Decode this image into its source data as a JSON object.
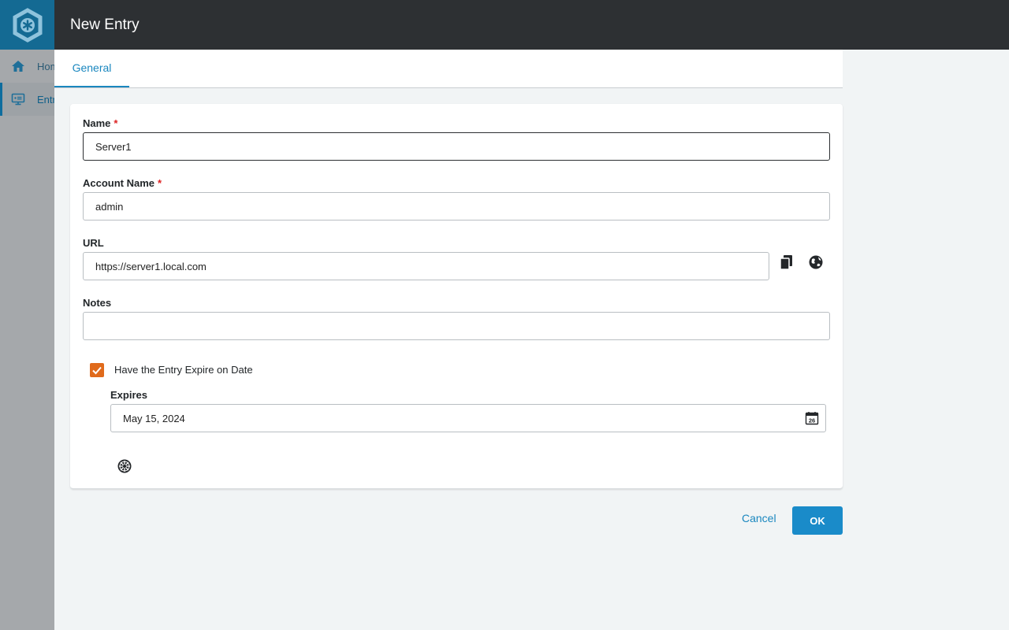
{
  "background_app": {
    "nav": [
      {
        "label": "Home",
        "icon": "home-icon"
      },
      {
        "label": "Entries",
        "icon": "entries-icon"
      }
    ]
  },
  "dialog": {
    "title": "New Entry",
    "tabs": [
      {
        "label": "General",
        "active": true
      }
    ],
    "fields": {
      "name": {
        "label": "Name",
        "required_marker": "*",
        "value": "Server1"
      },
      "account_name": {
        "label": "Account Name",
        "required_marker": "*",
        "value": "admin"
      },
      "url": {
        "label": "URL",
        "value": "https://server1.local.com"
      },
      "notes": {
        "label": "Notes",
        "value": ""
      }
    },
    "expire": {
      "checkbox_label": "Have the Entry Expire on Date",
      "checked": true,
      "expires_label": "Expires",
      "expires_value": "May 15, 2024",
      "calendar_day": "26"
    },
    "buttons": {
      "cancel": "Cancel",
      "ok": "OK"
    }
  },
  "colors": {
    "header_bg": "#2d3033",
    "accent": "#1a87bf",
    "checkbox": "#e06a1b",
    "logo_bg": "#146a93"
  }
}
